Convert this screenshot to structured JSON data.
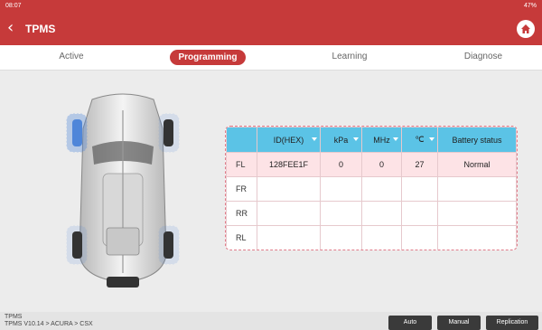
{
  "status": {
    "time": "08:07",
    "battery": "47%"
  },
  "header": {
    "title": "TPMS",
    "back_glyph": "‹"
  },
  "tabs": [
    {
      "label": "Active"
    },
    {
      "label": "Programming"
    },
    {
      "label": "Learning"
    },
    {
      "label": "Diagnose"
    }
  ],
  "active_tab": "Programming",
  "table": {
    "headers": [
      "ID(HEX)",
      "kPa",
      "MHz",
      "℃",
      "Battery status"
    ],
    "rows": [
      {
        "pos": "FL",
        "id": "128FEE1F",
        "kpa": "0",
        "mhz": "0",
        "temp": "27",
        "battery": "Normal"
      },
      {
        "pos": "FR",
        "id": "",
        "kpa": "",
        "mhz": "",
        "temp": "",
        "battery": ""
      },
      {
        "pos": "RR",
        "id": "",
        "kpa": "",
        "mhz": "",
        "temp": "",
        "battery": ""
      },
      {
        "pos": "RL",
        "id": "",
        "kpa": "",
        "mhz": "",
        "temp": "",
        "battery": ""
      }
    ]
  },
  "footer": {
    "line1": "TPMS",
    "line2": "TPMS V10.14 > ACURA > CSX",
    "buttons": {
      "auto": "Auto",
      "manual": "Manual",
      "replication": "Replication"
    }
  },
  "colors": {
    "accent": "#c63a3a",
    "table_header": "#5bc3e6",
    "highlight_row": "#fde3e6",
    "sensor": "#4f86d9"
  }
}
